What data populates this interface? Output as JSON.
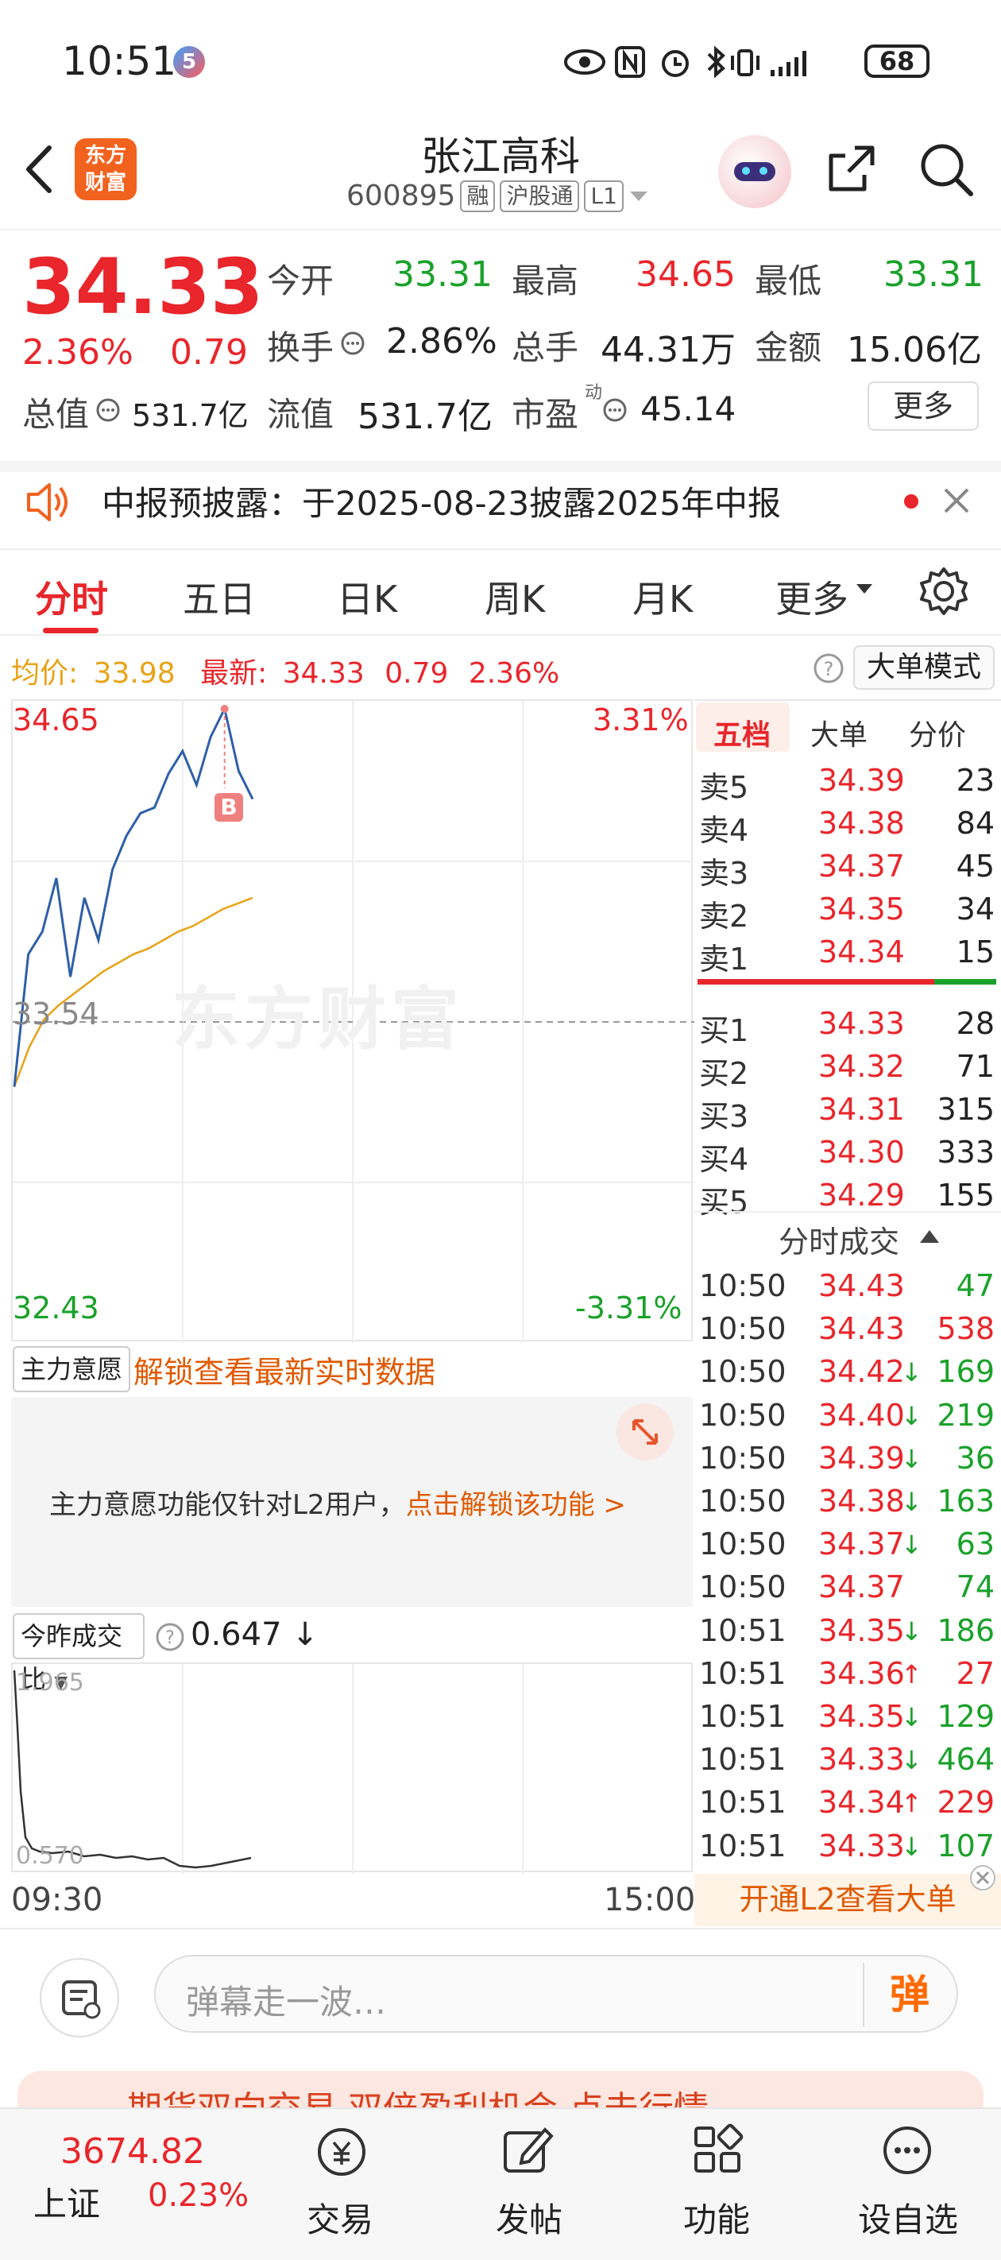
{
  "status_bar": {
    "time": "10:51",
    "battery": "68"
  },
  "header": {
    "logo_line1": "东方",
    "logo_line2": "财富",
    "stock_name": "张江高科",
    "stock_code": "600895",
    "tag_margin": "融",
    "tag_connect": "沪股通",
    "tag_level": "L1"
  },
  "quote": {
    "price": "34.33",
    "change_pct": "2.36%",
    "change_amt": "0.79",
    "open_label": "今开",
    "open": "33.31",
    "high_label": "最高",
    "high": "34.65",
    "low_label": "最低",
    "low": "33.31",
    "turnover_label": "换手",
    "turnover": "2.86%",
    "volume_label": "总手",
    "volume": "44.31万",
    "amount_label": "金额",
    "amount": "15.06亿",
    "mktcap_label": "总值",
    "mktcap": "531.7亿",
    "float_label": "流值",
    "float": "531.7亿",
    "pe_label": "市盈",
    "pe_sup": "动",
    "pe": "45.14",
    "more_label": "更多"
  },
  "notice": {
    "text": "中报预披露：于2025-08-23披露2025年中报"
  },
  "tabs": [
    {
      "label": "分时",
      "active": true
    },
    {
      "label": "五日"
    },
    {
      "label": "日K"
    },
    {
      "label": "周K"
    },
    {
      "label": "月K"
    },
    {
      "label": "更多"
    }
  ],
  "info_line": {
    "avg_label": "均价:",
    "avg": "33.98",
    "latest_label": "最新:",
    "latest": "34.33",
    "chg": "0.79",
    "pct": "2.36%",
    "big_order_mode": "大单模式"
  },
  "chart": {
    "high_price": "34.65",
    "high_pct": "3.31%",
    "ref_price": "33.54",
    "low_price": "32.43",
    "low_pct": "-3.31%",
    "watermark": "东方财富",
    "buy_marker": "B"
  },
  "chart_data": {
    "type": "line",
    "ylim": [
      32.43,
      34.65
    ],
    "reference": 33.54,
    "series": [
      {
        "name": "均价",
        "color": "#e8a317",
        "values": [
          33.31,
          33.45,
          33.55,
          33.6,
          33.64,
          33.68,
          33.72,
          33.75,
          33.78,
          33.8,
          33.83,
          33.86,
          33.88,
          33.91,
          33.94,
          33.96,
          33.98
        ]
      },
      {
        "name": "最新",
        "color": "#2f5fa8",
        "values": [
          33.31,
          33.78,
          33.86,
          34.05,
          33.7,
          33.98,
          33.83,
          34.08,
          34.2,
          34.28,
          34.3,
          34.42,
          34.5,
          34.38,
          34.55,
          34.65,
          34.43,
          34.33
        ]
      }
    ]
  },
  "order_book": {
    "tabs": [
      "五档",
      "大单",
      "分价"
    ],
    "asks": [
      {
        "label": "卖5",
        "price": "34.39",
        "vol": "23"
      },
      {
        "label": "卖4",
        "price": "34.38",
        "vol": "84"
      },
      {
        "label": "卖3",
        "price": "34.37",
        "vol": "45"
      },
      {
        "label": "卖2",
        "price": "34.35",
        "vol": "34"
      },
      {
        "label": "卖1",
        "price": "34.34",
        "vol": "15"
      }
    ],
    "bids": [
      {
        "label": "买1",
        "price": "34.33",
        "vol": "28"
      },
      {
        "label": "买2",
        "price": "34.32",
        "vol": "71"
      },
      {
        "label": "买3",
        "price": "34.31",
        "vol": "315"
      },
      {
        "label": "买4",
        "price": "34.30",
        "vol": "333"
      },
      {
        "label": "买5",
        "price": "34.29",
        "vol": "155"
      }
    ],
    "ticks_header": "分时成交",
    "ticks": [
      {
        "t": "10:50",
        "p": "34.43",
        "arrow": "",
        "v": "47",
        "vc": "green"
      },
      {
        "t": "10:50",
        "p": "34.43",
        "arrow": "",
        "v": "538",
        "vc": "red"
      },
      {
        "t": "10:50",
        "p": "34.42",
        "arrow": "↓",
        "v": "169",
        "vc": "green"
      },
      {
        "t": "10:50",
        "p": "34.40",
        "arrow": "↓",
        "v": "219",
        "vc": "green"
      },
      {
        "t": "10:50",
        "p": "34.39",
        "arrow": "↓",
        "v": "36",
        "vc": "green"
      },
      {
        "t": "10:50",
        "p": "34.38",
        "arrow": "↓",
        "v": "163",
        "vc": "green"
      },
      {
        "t": "10:50",
        "p": "34.37",
        "arrow": "↓",
        "v": "63",
        "vc": "green"
      },
      {
        "t": "10:50",
        "p": "34.37",
        "arrow": "",
        "v": "74",
        "vc": "green"
      },
      {
        "t": "10:51",
        "p": "34.35",
        "arrow": "↓",
        "v": "186",
        "vc": "green"
      },
      {
        "t": "10:51",
        "p": "34.36",
        "arrow": "↑",
        "v": "27",
        "vc": "red"
      },
      {
        "t": "10:51",
        "p": "34.35",
        "arrow": "↓",
        "v": "129",
        "vc": "green"
      },
      {
        "t": "10:51",
        "p": "34.33",
        "arrow": "↓",
        "v": "464",
        "vc": "green"
      },
      {
        "t": "10:51",
        "p": "34.34",
        "arrow": "↑",
        "v": "229",
        "vc": "red"
      },
      {
        "t": "10:51",
        "p": "34.33",
        "arrow": "↓",
        "v": "107",
        "vc": "green"
      }
    ],
    "l2_prompt": "开通L2查看大单"
  },
  "indicators": {
    "main_intent_label": "主力意愿",
    "unlock_link": "解锁查看最新实时数据",
    "intent_msg": "主力意愿功能仅针对L2用户，",
    "intent_link": "点击解锁该功能 >",
    "vol_ratio_label": "今昨成交比",
    "vol_ratio": "0.647",
    "vol_ratio_arrow": "↓",
    "vol_high": "1.965",
    "vol_low": "0.570",
    "time_start": "09:30",
    "time_end": "15:00"
  },
  "comment": {
    "placeholder": "弹幕走一波…",
    "danmu": "弹"
  },
  "ad": {
    "text": "期货双向交易  双倍盈利机会  点击行情"
  },
  "bottom_nav": {
    "index_value": "3674.82",
    "index_name": "上证",
    "index_pct": "0.23%",
    "items": [
      "交易",
      "发帖",
      "功能",
      "设自选"
    ]
  }
}
